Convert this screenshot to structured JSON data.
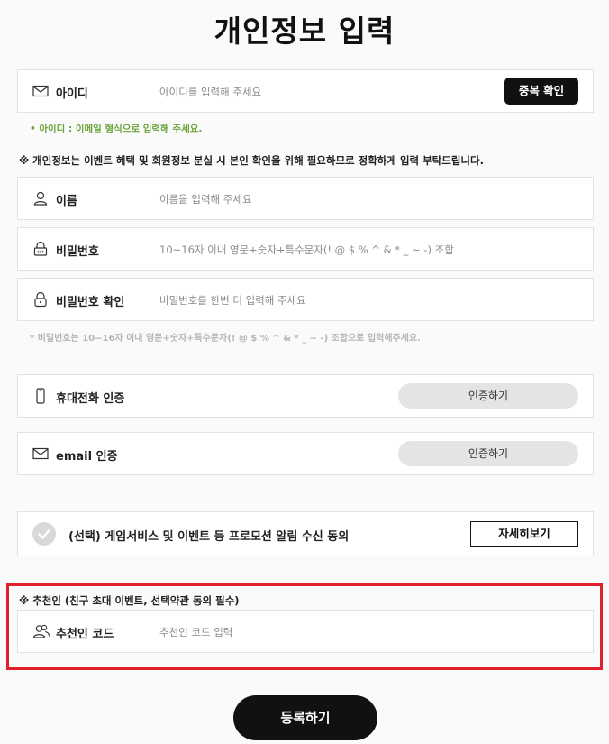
{
  "page": {
    "title": "개인정보 입력"
  },
  "id_field": {
    "label": "아이디",
    "placeholder": "아이디를 입력해 주세요",
    "check_button": "중복 확인",
    "note": "• 아이디 : 이메일 형식으로 입력해 주세요."
  },
  "privacy_note": "※ 개인정보는 이벤트 혜택 및 회원정보 분실 시 본인 확인을 위해 필요하므로 정확하게 입력 부탁드립니다.",
  "name_field": {
    "label": "이름",
    "placeholder": "이름을 입력해 주세요"
  },
  "password_field": {
    "label": "비밀번호",
    "placeholder": "10~16자 이내 영문+숫자+특수문자(! @ $ % ^ & * _ ~ -) 조합"
  },
  "password_confirm_field": {
    "label": "비밀번호 확인",
    "placeholder": "비밀번호를 한번 더 입력해 주세요"
  },
  "password_note": "* 비밀번호는 10~16자 이내 영문+숫자+특수문자(! @ $ % ^ & * _ ~ -) 조합으로 입력해주세요.",
  "phone_verify": {
    "label": "휴대전화 인증",
    "button": "인증하기"
  },
  "email_verify": {
    "label": "email 인증",
    "button": "인증하기"
  },
  "consent": {
    "label": "(선택) 게임서비스 및 이벤트 등 프로모션 알림 수신 동의",
    "detail_button": "자세히보기"
  },
  "referral": {
    "heading": "※ 추천인 (친구 초대 이벤트, 선택약관 동의 필수)",
    "label": "추천인 코드",
    "placeholder": "추천인 코드 입력"
  },
  "register_button": "등록하기",
  "colors": {
    "accent_green": "#6aa33a",
    "highlight_red": "#e0202a",
    "button_dark": "#111111"
  }
}
